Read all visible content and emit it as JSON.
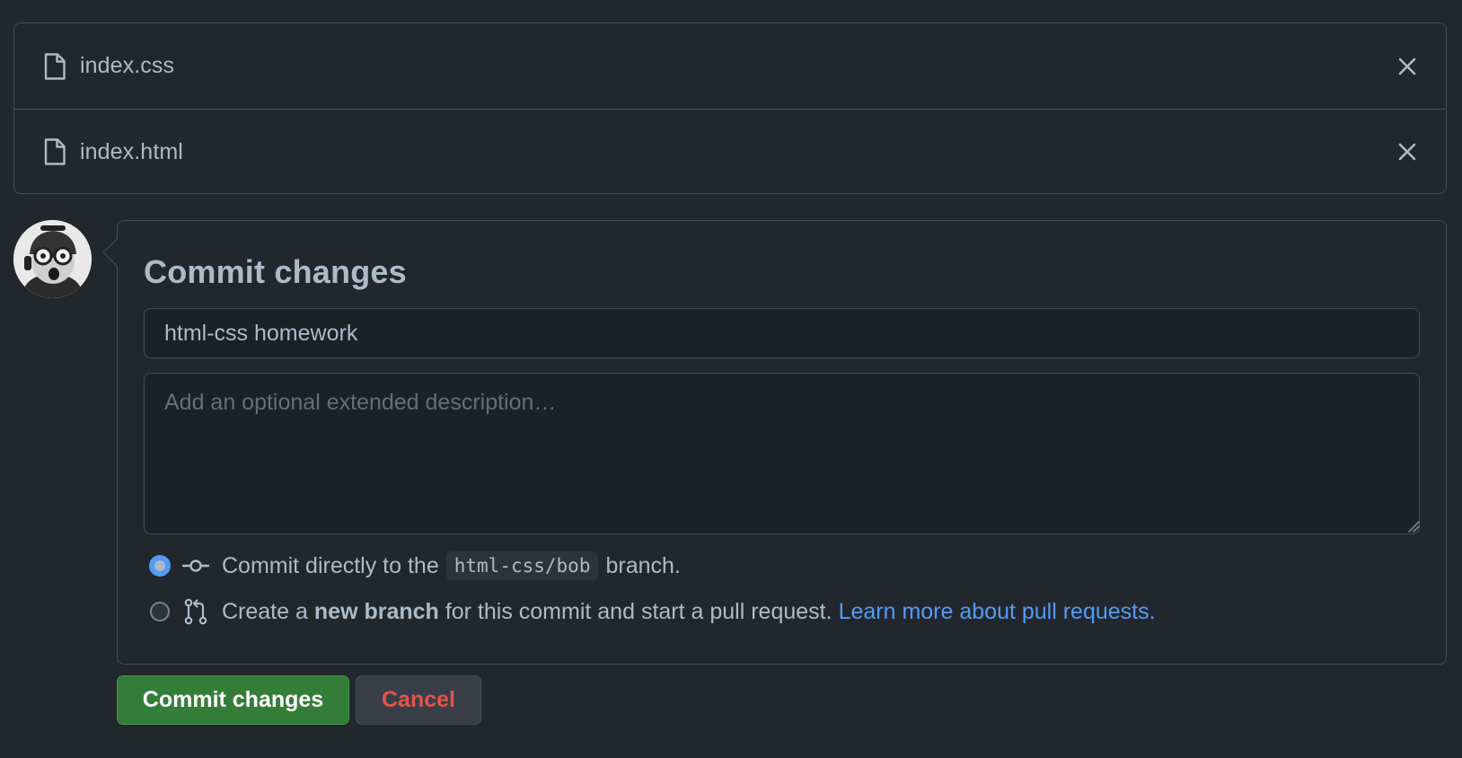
{
  "files": [
    {
      "name": "index.css",
      "icon": "file-icon",
      "action_icon": "close-icon"
    },
    {
      "name": "index.html",
      "icon": "file-icon",
      "action_icon": "close-icon"
    }
  ],
  "commit": {
    "title": "Commit changes",
    "summary_value": "html-css homework",
    "description_placeholder": "Add an optional extended description…",
    "option_direct": {
      "prefix": "Commit directly to the",
      "branch": "html-css/bob",
      "suffix": "branch.",
      "selected": true
    },
    "option_new_branch": {
      "prefix": "Create a",
      "bold": "new branch",
      "middle": "for this commit and start a pull request.",
      "link": "Learn more about pull requests.",
      "selected": false
    }
  },
  "buttons": {
    "commit_label": "Commit changes",
    "cancel_label": "Cancel"
  },
  "colors": {
    "background": "#22272e",
    "border": "#444c56",
    "accent": "#539bf5",
    "primary_button": "#347d39",
    "danger_text": "#e5534b"
  }
}
